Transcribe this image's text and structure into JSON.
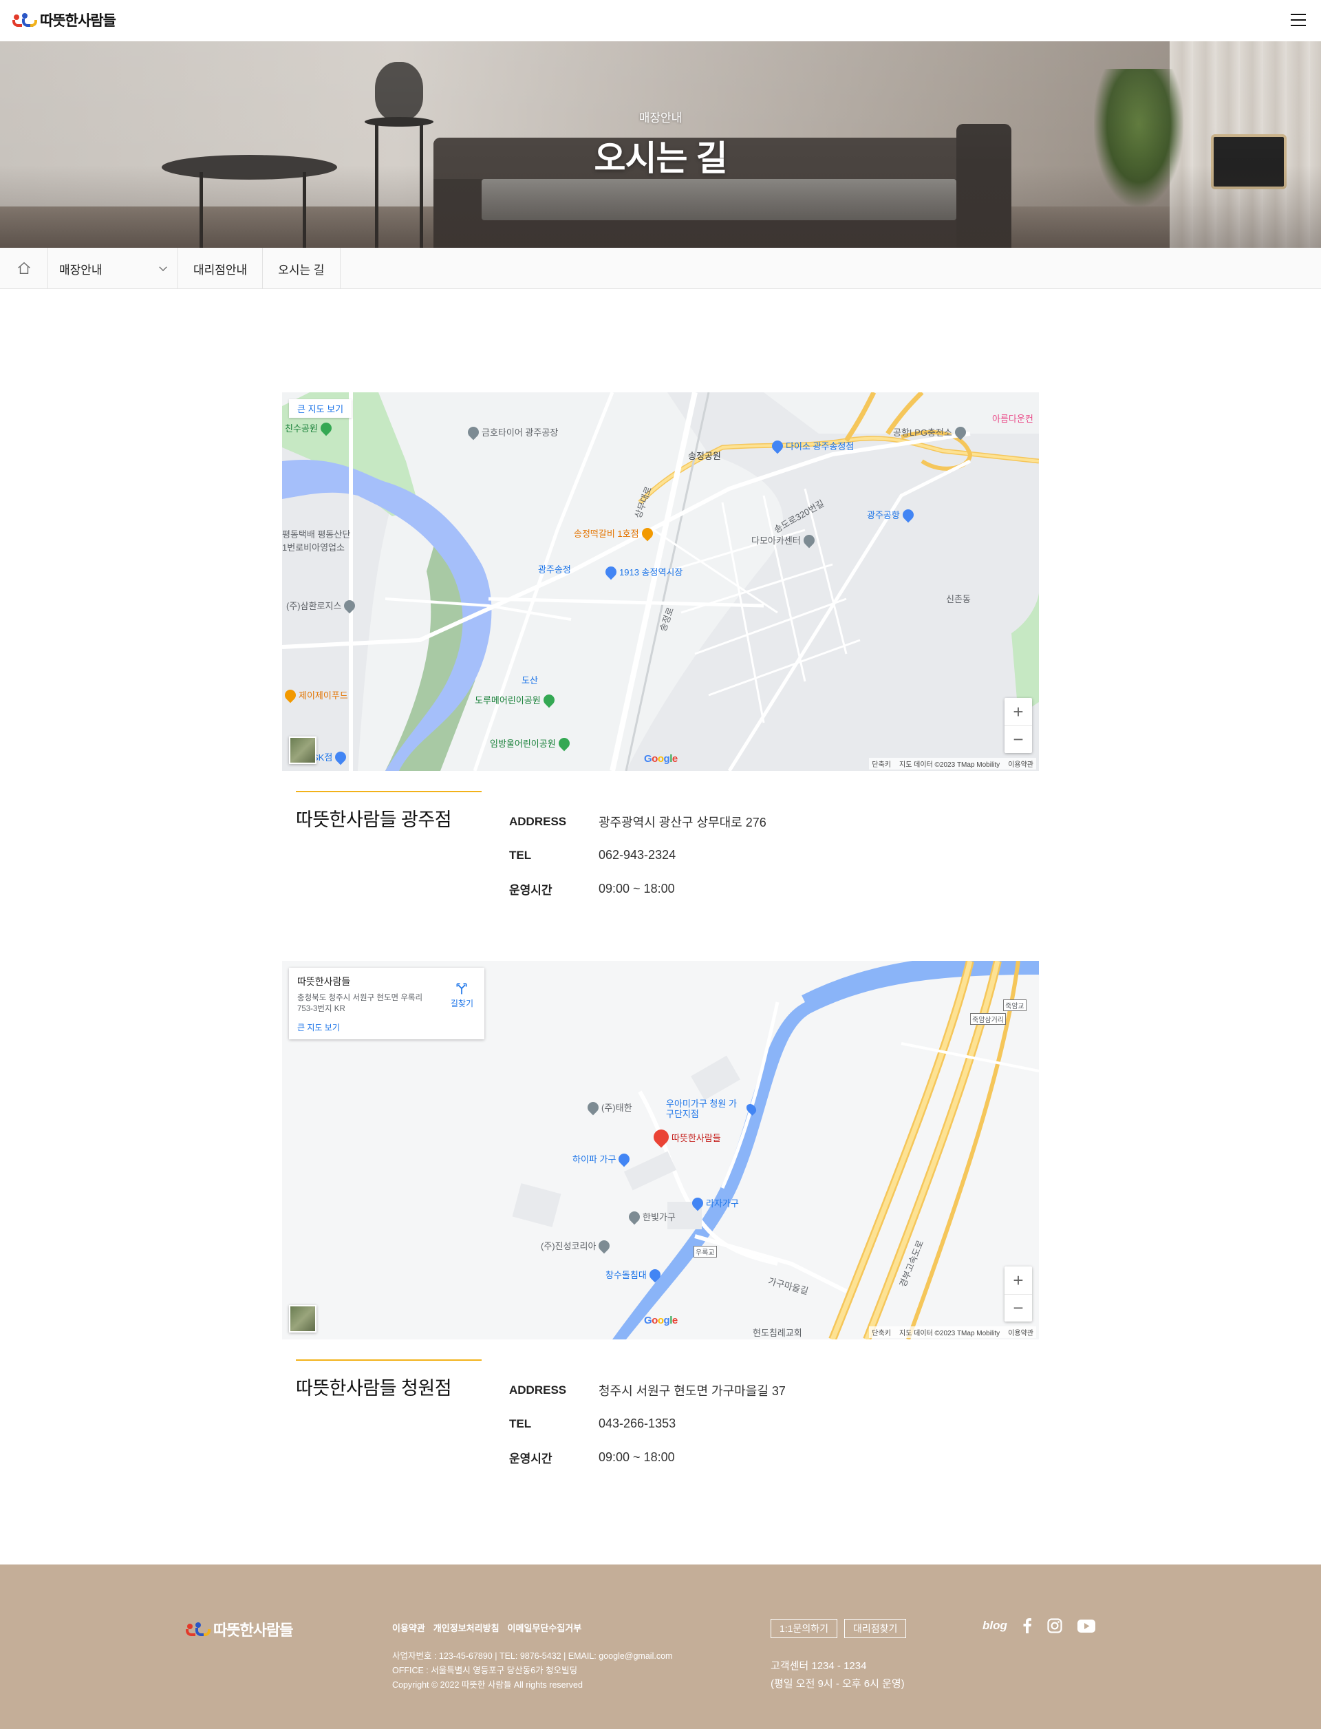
{
  "header": {
    "brand": "따뜻한사람들",
    "menu_icon": "hamburger-menu-icon"
  },
  "hero": {
    "subtitle": "매장안내",
    "title": "오시는 길"
  },
  "breadcrumb": {
    "home_icon": "home-icon",
    "section": "매장안내",
    "item1": "대리점안내",
    "item2": "오시는 길"
  },
  "stores": [
    {
      "map": {
        "link": "큰 지도 보기",
        "labels": [
          "금호타이어 광주공장",
          "송정공원",
          "다이소 광주송정점",
          "공항LPG충전소",
          "아름다운컨",
          "광주공항",
          "송정떡갈비 1호점",
          "다모아카센터",
          "광주송정",
          "1913 송정역시장",
          "(주)삼환로지스",
          "평동택배 평동산단 1번로비아영업소",
          "제이제이푸드",
          "도루메어린이공원",
          "도산",
          "임방울어린이공원",
          "SK점",
          "친수공원",
          "상무대로",
          "송정로",
          "송도로320번길",
          "신촌동"
        ],
        "google": [
          "G",
          "o",
          "o",
          "g",
          "l",
          "e"
        ],
        "attribution": [
          "단축키",
          "지도 데이터 ©2023 TMap Mobility",
          "이용약관"
        ]
      },
      "name": "따뜻한사람들 광주점",
      "rows": [
        {
          "key": "ADDRESS",
          "value": "광주광역시 광산구 상무대로 276"
        },
        {
          "key": "TEL",
          "value": "062-943-2324"
        },
        {
          "key": "운영시간",
          "value": "09:00 ~ 18:00"
        }
      ]
    },
    {
      "map": {
        "card_title": "따뜻한사람들",
        "card_address": "충청북도 청주시 서원구 현도면 우록리 753-3번지 KR",
        "card_link": "큰 지도 보기",
        "directions": "길찾기",
        "labels": [
          "(주)태한",
          "우아미가구 청원 가구단지점",
          "따뜻한사람들",
          "하이파 가구",
          "라자가구",
          "한빛가구",
          "(주)진성코리아",
          "창수돌침대",
          "가구마을길",
          "현도침례교회",
          "죽암교",
          "죽암삼거리",
          "우록교",
          "경부고속도로"
        ],
        "google": [
          "G",
          "o",
          "o",
          "g",
          "l",
          "e"
        ],
        "attribution": [
          "단축키",
          "지도 데이터 ©2023 TMap Mobility",
          "이용약관"
        ]
      },
      "name": "따뜻한사람들 청원점",
      "rows": [
        {
          "key": "ADDRESS",
          "value": "청주시 서원구 현도면 가구마을길 37"
        },
        {
          "key": "TEL",
          "value": "043-266-1353"
        },
        {
          "key": "운영시간",
          "value": "09:00 ~ 18:00"
        }
      ]
    }
  ],
  "footer": {
    "brand": "따뜻한사람들",
    "links": [
      "이용약관",
      "개인정보처리방침",
      "이메일무단수집거부"
    ],
    "info_lines": [
      "사업자번호 : 123-45-67890  |  TEL: 9876-5432  |  EMAIL: google@gmail.com",
      "OFFICE : 서울특별시 영등포구 당산동6가 청오빌딩",
      "Copyright © 2022 따뜻한 사람들 All rights reserved"
    ],
    "buttons": [
      "1:1문의하기",
      "대리점찾기"
    ],
    "cs_lines": [
      "고객센터 1234 - 1234",
      "(평일 오전 9시 - 오후 6시 운영)"
    ],
    "social": {
      "blog": "blog",
      "facebook_icon": "facebook-icon",
      "instagram_icon": "instagram-icon",
      "youtube_icon": "youtube-icon"
    }
  },
  "colors": {
    "accent": "#f2b21a",
    "footer_bg": "#c4ae98",
    "map_link": "#1a73e8"
  }
}
